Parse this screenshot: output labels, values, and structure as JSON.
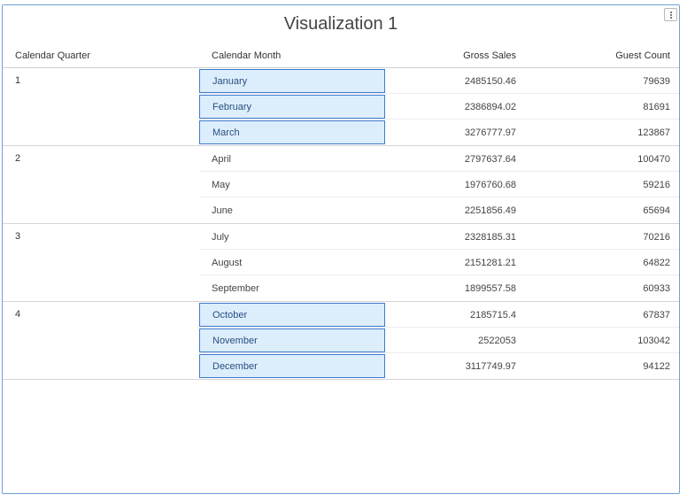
{
  "visualization": {
    "title": "Visualization 1"
  },
  "table": {
    "columns": [
      "Calendar Quarter",
      "Calendar Month",
      "Gross Sales",
      "Guest Count"
    ],
    "groups": [
      {
        "quarter": "1",
        "rows": [
          {
            "month": "January",
            "gross_sales": "2485150.46",
            "guest_count": "79639",
            "selected": true
          },
          {
            "month": "February",
            "gross_sales": "2386894.02",
            "guest_count": "81691",
            "selected": true
          },
          {
            "month": "March",
            "gross_sales": "3276777.97",
            "guest_count": "123867",
            "selected": true
          }
        ]
      },
      {
        "quarter": "2",
        "rows": [
          {
            "month": "April",
            "gross_sales": "2797637.64",
            "guest_count": "100470",
            "selected": false
          },
          {
            "month": "May",
            "gross_sales": "1976760.68",
            "guest_count": "59216",
            "selected": false
          },
          {
            "month": "June",
            "gross_sales": "2251856.49",
            "guest_count": "65694",
            "selected": false
          }
        ]
      },
      {
        "quarter": "3",
        "rows": [
          {
            "month": "July",
            "gross_sales": "2328185.31",
            "guest_count": "70216",
            "selected": false
          },
          {
            "month": "August",
            "gross_sales": "2151281.21",
            "guest_count": "64822",
            "selected": false
          },
          {
            "month": "September",
            "gross_sales": "1899557.58",
            "guest_count": "60933",
            "selected": false
          }
        ]
      },
      {
        "quarter": "4",
        "rows": [
          {
            "month": "October",
            "gross_sales": "2185715.4",
            "guest_count": "67837",
            "selected": true
          },
          {
            "month": "November",
            "gross_sales": "2522053",
            "guest_count": "103042",
            "selected": true
          },
          {
            "month": "December",
            "gross_sales": "3117749.97",
            "guest_count": "94122",
            "selected": true
          }
        ]
      }
    ]
  },
  "icons": {
    "menu": "more-vertical-icon"
  },
  "colors": {
    "panel_border": "#6f9fd8",
    "selection_fill": "#dcedfc",
    "selection_border": "#3f7ccf"
  }
}
